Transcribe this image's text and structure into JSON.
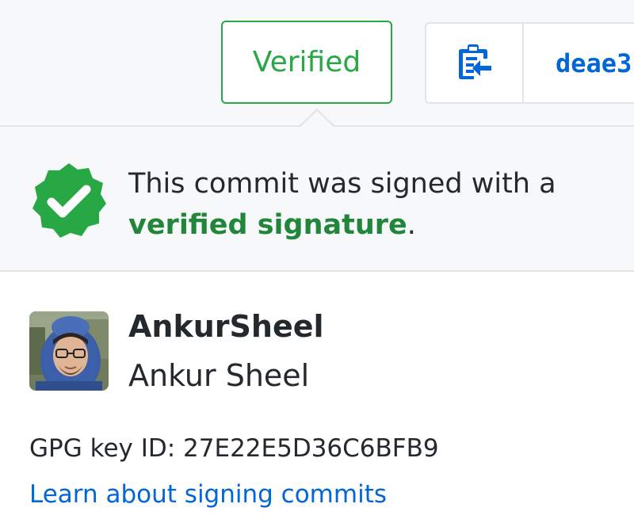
{
  "toolbar": {
    "verified_label": "Verified",
    "copy_icon": "clipboard-copy-icon",
    "sha_short": "deae3"
  },
  "popover": {
    "badge_icon": "verified-check-badge-icon",
    "message_prefix": "This commit was signed with a",
    "message_link": "verified signature",
    "message_suffix": ".",
    "user": {
      "username": "AnkurSheel",
      "full_name": "Ankur Sheel",
      "avatar": "user-avatar-photo"
    },
    "gpg_label": "GPG key ID:",
    "gpg_key_id": "27E22E5D36C6BFB9",
    "learn_link": "Learn about signing commits"
  },
  "colors": {
    "verified_green": "#28a745",
    "link_green": "#22863a",
    "link_blue": "#0366d6",
    "header_bg": "#f6f8fa",
    "border": "#e1e4e8"
  }
}
